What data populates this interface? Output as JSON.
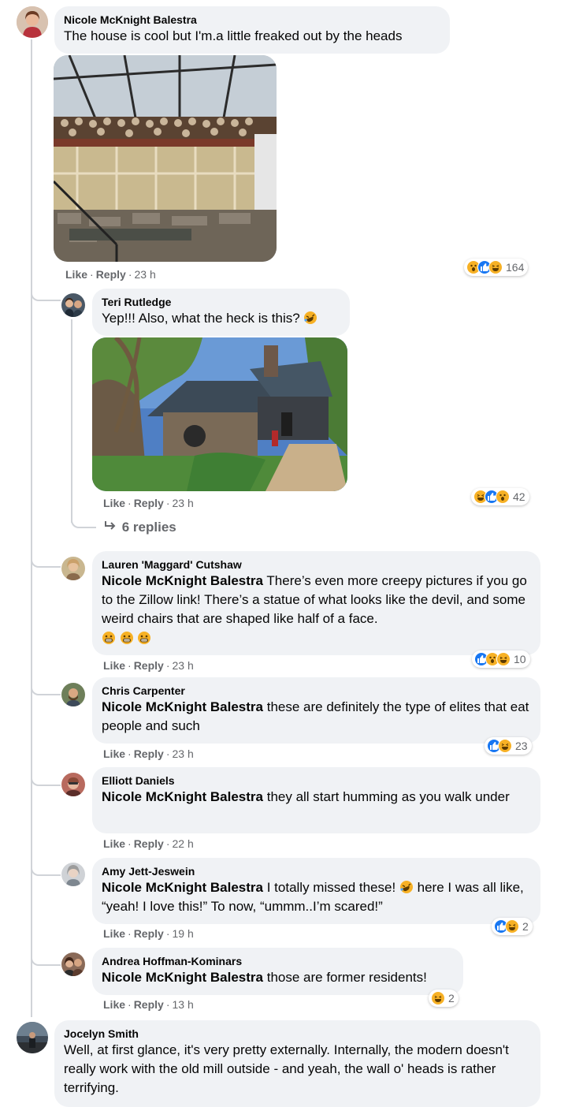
{
  "actions": {
    "like": "Like",
    "reply": "Reply",
    "separator": "·"
  },
  "comments": [
    {
      "author": "Nicole McKnight Balestra",
      "text": "The house is cool but I'm.a little freaked out by the heads",
      "time": "23 h",
      "reaction_count": "164",
      "reactions": [
        "wow-icon",
        "like-icon",
        "haha-icon"
      ],
      "photo": "solarium-with-wall-of-heads"
    },
    {
      "author": "Teri Rutledge",
      "text": "Yep!!! Also, what the heck is this?",
      "time": "23 h",
      "reaction_count": "42",
      "reactions": [
        "haha-icon",
        "like-icon",
        "wow-icon"
      ],
      "photo": "stone-house-exterior",
      "replies_label": "6 replies"
    },
    {
      "author": "Lauren 'Maggard' Cutshaw",
      "mention": "Nicole McKnight Balestra",
      "text": " There’s even more creepy pictures if you go to the Zillow link! There’s a statue of what looks like the devil, and some weird chairs that are shaped like half of a face.",
      "time": "23 h",
      "reaction_count": "10",
      "reactions": [
        "like-icon",
        "wow-icon",
        "haha-icon"
      ]
    },
    {
      "author": "Chris Carpenter",
      "mention": "Nicole McKnight Balestra",
      "text": " these are definitely the type of elites that eat people and such",
      "time": "23 h",
      "reaction_count": "23",
      "reactions": [
        "like-icon",
        "haha-icon"
      ]
    },
    {
      "author": "Elliott Daniels",
      "mention": "Nicole McKnight Balestra",
      "text": " they all start humming as you walk under",
      "time": "22 h"
    },
    {
      "author": "Amy Jett-Jeswein",
      "mention": "Nicole McKnight Balestra",
      "text_a": " I totally missed these! ",
      "text_b": " here I was all like, “yeah! I love this!” To now, “ummm..I’m scared!”",
      "time": "19 h",
      "reaction_count": "2",
      "reactions": [
        "like-icon",
        "haha-icon"
      ]
    },
    {
      "author": "Andrea Hoffman-Kominars",
      "mention": "Nicole McKnight Balestra",
      "text": " those are former residents!",
      "time": "13 h",
      "reaction_count": "2",
      "reactions": [
        "haha-icon"
      ]
    },
    {
      "author": "Jocelyn Smith",
      "text": "Well, at first glance, it's very pretty externally. Internally, the modern doesn't really work with the old mill outside - and yeah, the wall o' heads is rather terrifying."
    }
  ],
  "colors": {
    "bubble": "#f0f2f5",
    "meta_text": "#65676b",
    "like_blue": "#1877f2",
    "emoji_yellow": "#f7b125"
  }
}
